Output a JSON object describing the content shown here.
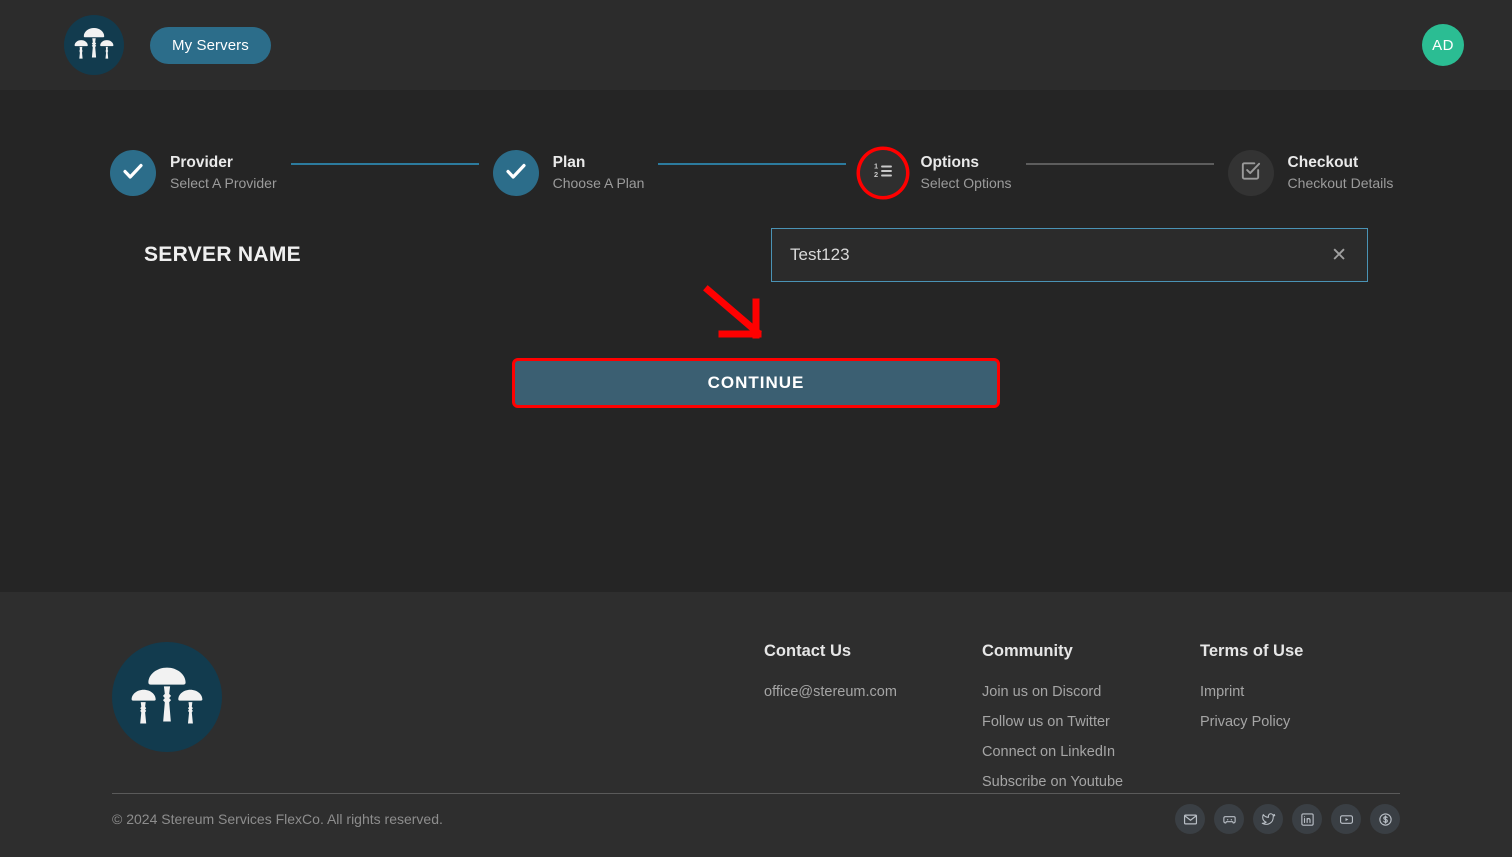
{
  "header": {
    "logo_icon": "mushroom-logo-icon",
    "my_servers_label": "My Servers",
    "avatar_initials": "AD"
  },
  "stepper": {
    "steps": [
      {
        "title": "Provider",
        "subtitle": "Select A Provider",
        "state": "done",
        "icon": "check-icon",
        "annotated": false
      },
      {
        "title": "Plan",
        "subtitle": "Choose A Plan",
        "state": "done",
        "icon": "check-icon",
        "annotated": false
      },
      {
        "title": "Options",
        "subtitle": "Select Options",
        "state": "current",
        "icon": "numbered-list-icon",
        "annotated": true
      },
      {
        "title": "Checkout",
        "subtitle": "Checkout Details",
        "state": "pending",
        "icon": "checkbox-icon",
        "annotated": false
      }
    ],
    "connectors": [
      "done",
      "done",
      "pending"
    ]
  },
  "form": {
    "server_name_label": "SERVER NAME",
    "server_name_value": "Test123",
    "server_name_placeholder": "",
    "clear_icon": "close-icon",
    "continue_label": "CONTINUE"
  },
  "annotations": {
    "arrow_color": "#ff0000",
    "highlight_color": "#ff0000"
  },
  "footer": {
    "logo_icon": "mushroom-logo-icon",
    "columns": [
      {
        "title": "Contact Us",
        "links": [
          "office@stereum.com"
        ]
      },
      {
        "title": "Community",
        "links": [
          "Join us on Discord",
          "Follow us on Twitter",
          "Connect on LinkedIn",
          "Subscribe on Youtube"
        ]
      },
      {
        "title": "Terms of Use",
        "links": [
          "Imprint",
          "Privacy Policy"
        ]
      }
    ],
    "copyright": "© 2024 Stereum Services FlexCo. All rights reserved.",
    "socials": [
      "email-icon",
      "discord-icon",
      "twitter-icon",
      "linkedin-icon",
      "youtube-icon",
      "donate-icon"
    ]
  },
  "colors": {
    "accent_teal": "#2c6d8a",
    "logo_bg": "#123b4e",
    "avatar_green": "#2bbd93",
    "annotation_red": "#ff0000",
    "continue_bg": "#3b5f72",
    "input_border": "#4a93b5",
    "page_bg": "#252525",
    "header_bg": "#2c2c2c",
    "footer_bg": "#2e2e2e"
  }
}
